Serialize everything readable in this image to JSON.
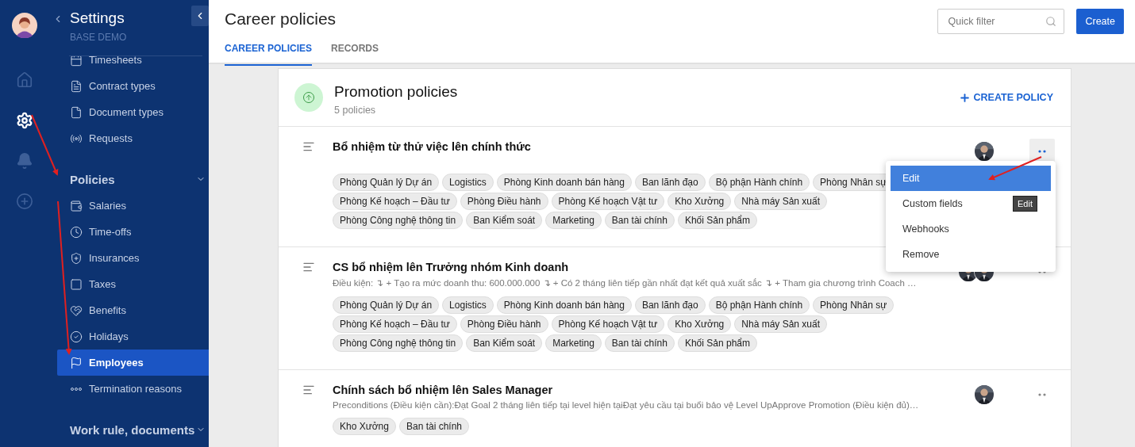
{
  "rail": {
    "items": [
      {
        "kind": "home",
        "selected": false
      },
      {
        "kind": "settings",
        "selected": true
      },
      {
        "kind": "bell",
        "selected": false
      },
      {
        "kind": "plus",
        "selected": false
      }
    ]
  },
  "sidebar": {
    "title": "Settings",
    "subtitle": "BASE DEMO",
    "items": [
      {
        "label": "Timesheets",
        "selected": false
      },
      {
        "label": "Contract types",
        "selected": false
      },
      {
        "label": "Document types",
        "selected": false
      },
      {
        "label": "Requests",
        "selected": false
      }
    ],
    "groups": [
      {
        "label": "Policies",
        "items": [
          {
            "label": "Salaries",
            "selected": false
          },
          {
            "label": "Time-offs",
            "selected": false
          },
          {
            "label": "Insurances",
            "selected": false
          },
          {
            "label": "Taxes",
            "selected": false
          },
          {
            "label": "Benefits",
            "selected": false
          },
          {
            "label": "Holidays",
            "selected": false
          },
          {
            "label": "Employees",
            "selected": true
          },
          {
            "label": "Termination reasons",
            "selected": false
          }
        ]
      },
      {
        "label": "Work rule, documents"
      }
    ]
  },
  "header": {
    "title": "Career policies",
    "tabs": [
      {
        "label": "CAREER POLICIES",
        "selected": true
      },
      {
        "label": "RECORDS",
        "selected": false
      }
    ],
    "search": {
      "placeholder": "Quick filter"
    },
    "create_button": "Create"
  },
  "card": {
    "title": "Promotion policies",
    "count": "5 policies",
    "create_policy": "CREATE POLICY",
    "policies": [
      {
        "title": "Bổ nhiệm từ thử việc lên chính thức",
        "avatars": [
          {
            "kind": "picture"
          }
        ],
        "menu_active": true,
        "tags": [
          "Phòng Quản lý Dự án",
          "Logistics",
          "Phòng Kinh doanh bán hàng",
          "Ban lãnh đạo",
          "Bộ phận Hành chính",
          "Phòng Nhân sự",
          "Phòng Kế hoạch – Đầu tư",
          "Phòng Điều hành",
          "Phòng Kế hoạch Vật tư",
          "Kho Xưởng",
          "Nhà máy Sản xuất",
          "Phòng Công nghệ thông tin",
          "Ban Kiểm soát",
          "Marketing",
          "Ban tài chính",
          "Khối Sản phẩm"
        ]
      },
      {
        "title": "CS bổ nhiệm lên Trưởng nhóm Kinh doanh",
        "description": "Điều kiện: ↴ + Tạo ra mức doanh thu: 600.000.000 ↴ + Có 2 tháng liên tiếp gần nhất đạt kết quả xuất sắc ↴ + Tham gia chương trình Coach …",
        "avatars": [
          {
            "kind": "picture"
          },
          {
            "kind": "picture"
          }
        ],
        "menu_active": false,
        "tags": [
          "Phòng Quản lý Dự án",
          "Logistics",
          "Phòng Kinh doanh bán hàng",
          "Ban lãnh đạo",
          "Bộ phận Hành chính",
          "Phòng Nhân sự",
          "Phòng Kế hoạch – Đầu tư",
          "Phòng Điều hành",
          "Phòng Kế hoạch Vật tư",
          "Kho Xưởng",
          "Nhà máy Sản xuất",
          "Phòng Công nghệ thông tin",
          "Ban Kiểm soát",
          "Marketing",
          "Ban tài chính",
          "Khối Sản phẩm"
        ]
      },
      {
        "title": "Chính sách bổ nhiệm lên Sales Manager",
        "description": "Preconditions (Điều kiện cần):Đạt Goal 2 tháng liên tiếp tại level hiện tạiĐạt yêu cầu tại buổi bảo vệ Level UpApprove Promotion (Điều kiện đủ)…",
        "avatars": [
          {
            "kind": "picture"
          }
        ],
        "menu_active": false,
        "tags": [
          "Kho Xưởng",
          "Ban tài chính"
        ]
      }
    ]
  },
  "menu": {
    "items": [
      {
        "label": "Edit",
        "selected": true
      },
      {
        "label": "Custom fields",
        "selected": false
      },
      {
        "label": "Webhooks",
        "selected": false
      },
      {
        "label": "Remove",
        "selected": false
      }
    ],
    "tooltip": "Edit"
  }
}
